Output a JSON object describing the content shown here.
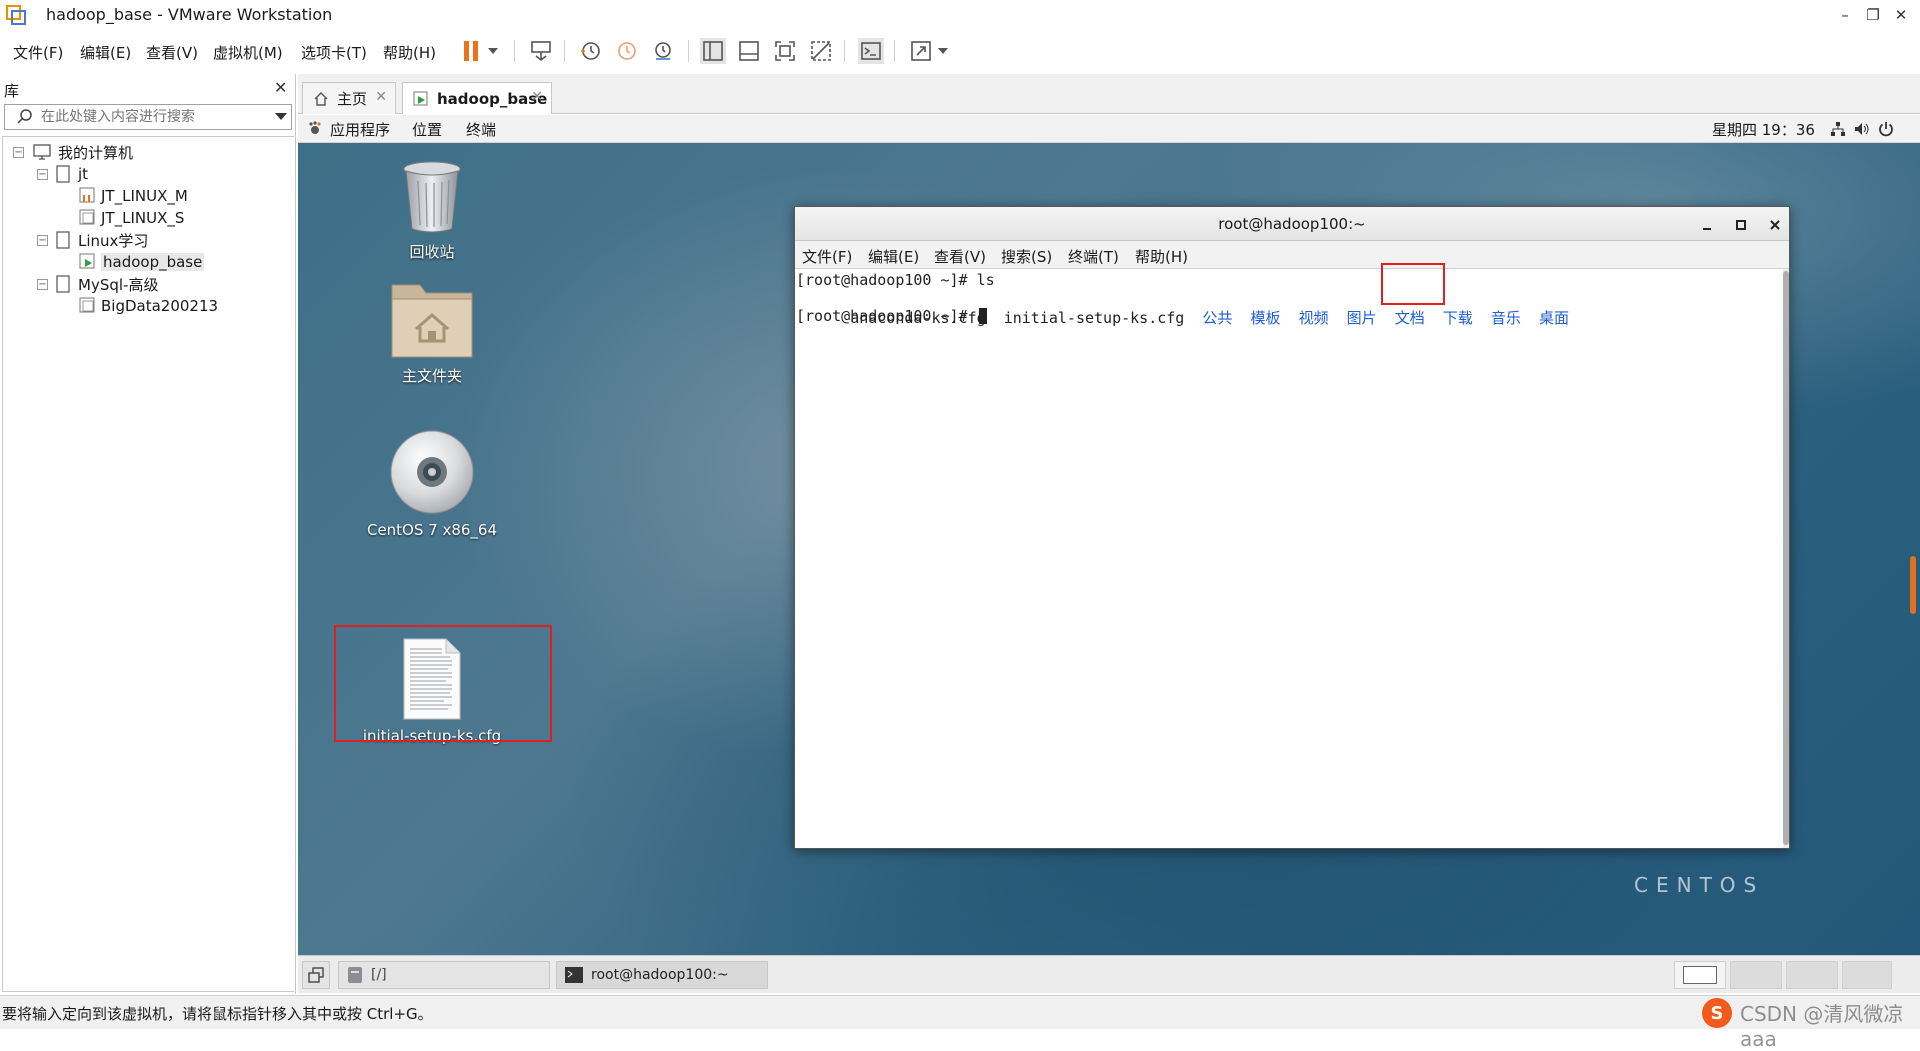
{
  "window": {
    "title": "hadoop_base - VMware Workstation",
    "controls": [
      "–",
      "❐",
      "✕"
    ]
  },
  "menubar": {
    "items": [
      "文件(F)",
      "编辑(E)",
      "查看(V)",
      "虚拟机(M)",
      "选项卡(T)",
      "帮助(H)"
    ]
  },
  "library": {
    "title": "库",
    "close": "✕",
    "search_placeholder": "在此处键入内容进行搜索",
    "tree": {
      "root": "我的计算机",
      "groups": [
        {
          "label": "jt",
          "children": [
            "JT_LINUX_M",
            "JT_LINUX_S"
          ]
        },
        {
          "label": "Linux学习",
          "children": [
            "hadoop_base"
          ]
        },
        {
          "label": "MySql-高级",
          "children": [
            "BigData200213"
          ]
        }
      ],
      "selected": "hadoop_base"
    }
  },
  "tabs": [
    {
      "label": "主页",
      "close": "✕"
    },
    {
      "label": "hadoop_base",
      "close": "✕"
    }
  ],
  "gnome": {
    "applications": "应用程序",
    "places": "位置",
    "terminal": "终端",
    "clock": "星期四 19：36"
  },
  "desktop": {
    "icons": [
      {
        "label": "回收站",
        "icon": "trash-icon"
      },
      {
        "label": "主文件夹",
        "icon": "home-folder-icon"
      },
      {
        "label": "CentOS 7 x86_64",
        "icon": "disc-icon"
      },
      {
        "label": "initial-setup-ks.cfg",
        "icon": "text-file-icon"
      }
    ],
    "watermark": "CENTOS"
  },
  "terminal": {
    "title": "root@hadoop100:~",
    "menu": [
      "文件(F)",
      "编辑(E)",
      "查看(V)",
      "搜索(S)",
      "终端(T)",
      "帮助(H)"
    ],
    "line1": "[root@hadoop100 ~]# ls",
    "files_plain": [
      "anaconda-ks.cfg",
      "initial-setup-ks.cfg"
    ],
    "dirs": [
      "公共",
      "模板",
      "视频",
      "图片",
      "文档",
      "下载",
      "音乐",
      "桌面"
    ],
    "prompt": "[root@hadoop100 ~]# ",
    "dir_color": "#1f5fd0"
  },
  "taskbar": {
    "files_window": "[/]",
    "terminal_window": "root@hadoop100:~"
  },
  "statusbar": {
    "text": "要将输入定向到该虚拟机，请将鼠标指针移入其中或按 Ctrl+G。",
    "watermark": "CSDN @清风微凉 aaa"
  },
  "colors": {
    "highlight_box": "#e02020",
    "accent": "#e07020"
  }
}
